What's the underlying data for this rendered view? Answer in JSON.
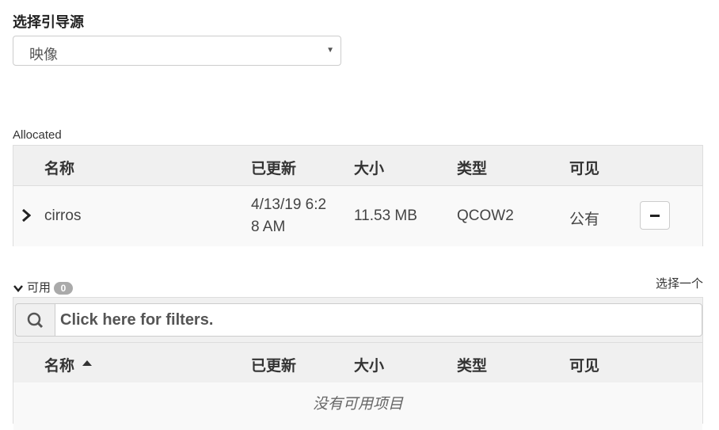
{
  "boot_source": {
    "label": "选择引导源",
    "selected": "映像"
  },
  "allocated": {
    "label": "Allocated",
    "columns": [
      "名称",
      "已更新",
      "大小",
      "类型",
      "可见"
    ],
    "rows": [
      {
        "name": "cirros",
        "updated_line1": "4/13/19 6:2",
        "updated_line2": "8 AM",
        "size": "11.53 MB",
        "type": "QCOW2",
        "visibility": "公有"
      }
    ]
  },
  "available": {
    "label": "可用",
    "count": "0",
    "select_one": "选择一个",
    "filter_placeholder": "Click here for filters.",
    "columns": [
      "名称",
      "已更新",
      "大小",
      "类型",
      "可见"
    ],
    "empty_text": "没有可用项目"
  },
  "icons": [
    "chevron-down-icon",
    "chevron-right-icon",
    "search-icon",
    "minus-icon",
    "sort-up-icon"
  ]
}
